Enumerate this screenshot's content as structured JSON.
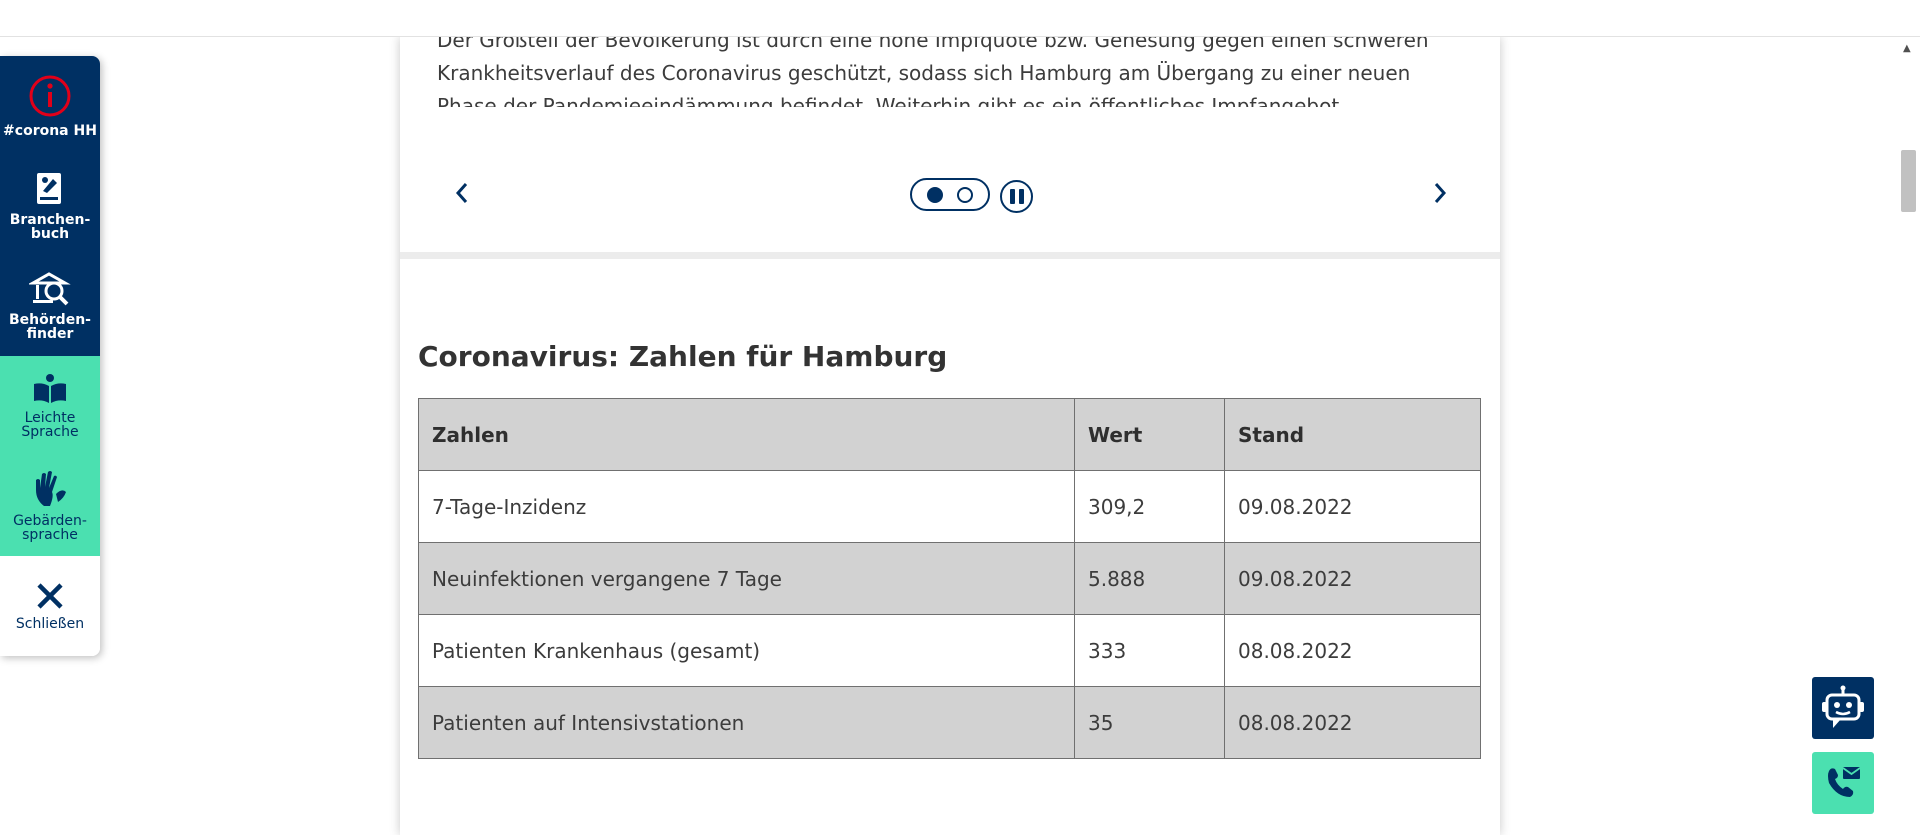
{
  "intro": {
    "lines": [
      "Der Großteil der Bevölkerung ist durch eine hohe Impfquote bzw. Genesung gegen einen schweren",
      "Krankheitsverlauf des Coronavirus geschützt, sodass sich Hamburg am Übergang zu einer neuen",
      "Phase der Pandemieeindämmung befindet. Weiterhin gibt es ein öffentliches Impfangebot."
    ]
  },
  "slider": {
    "prev_icon": "chevron-left-icon",
    "next_icon": "chevron-right-icon",
    "dots": 2,
    "active_dot": 1,
    "pause_icon": "pause-icon"
  },
  "section": {
    "title": "Coronavirus: Zahlen für Hamburg"
  },
  "table": {
    "headers": [
      "Zahlen",
      "Wert",
      "Stand"
    ],
    "rows": [
      [
        "7-Tage-Inzidenz",
        "309,2",
        "09.08.2022"
      ],
      [
        "Neuinfektionen vergangene 7 Tage",
        "5.888",
        "09.08.2022"
      ],
      [
        "Patienten Krankenhaus (gesamt)",
        "333",
        "08.08.2022"
      ],
      [
        "Patienten auf Intensivstationen",
        "35",
        "08.08.2022"
      ]
    ]
  },
  "sidebar": {
    "items": [
      {
        "label": "#corona HH",
        "icon": "info-icon"
      },
      {
        "label": "Branchen-\nbuch",
        "icon": "directory-book-icon"
      },
      {
        "label": "Behörden-\nfinder",
        "icon": "authority-search-icon"
      },
      {
        "label": "Leichte\nSprache",
        "icon": "open-book-icon"
      },
      {
        "label": "Gebärden-\nsprache",
        "icon": "sign-language-hands-icon"
      },
      {
        "label": "Schließen",
        "icon": "close-icon"
      }
    ]
  },
  "floating": {
    "chatbot_icon": "chatbot-icon",
    "contact_icon": "phone-mail-icon"
  },
  "colors": {
    "navy": "#003063",
    "mint": "#4be0b0",
    "info_red": "#e10019",
    "table_gray": "#d2d2d2"
  }
}
